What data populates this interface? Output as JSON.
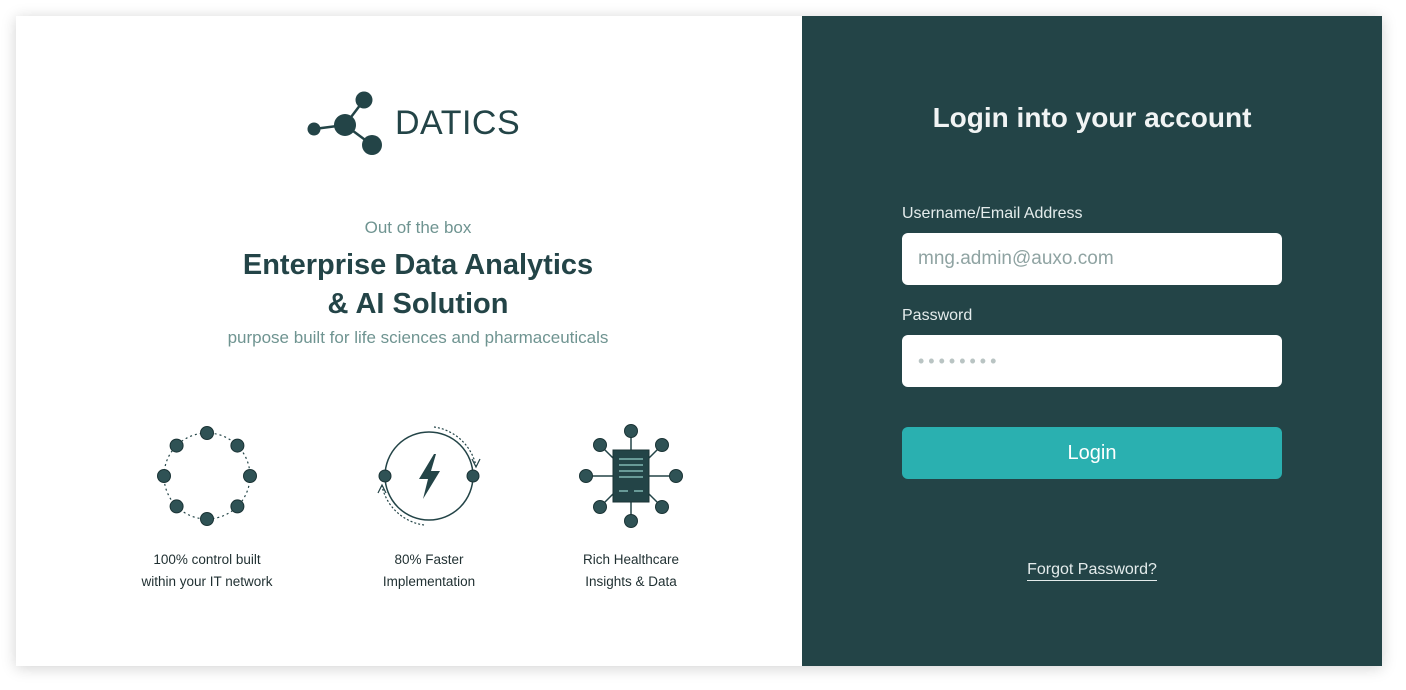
{
  "brand": {
    "name": "DATICS",
    "color": "#234447",
    "logo_icon": "molecule-network-icon"
  },
  "tagline": {
    "kicker": "Out of the box",
    "title_line1": "Enterprise Data Analytics",
    "title_line2": "& AI Solution",
    "subtitle": "purpose built for life sciences and pharmaceuticals"
  },
  "features": [
    {
      "icon": "ring-network-icon",
      "line1": "100% control built",
      "line2": "within your IT network"
    },
    {
      "icon": "lightning-cycle-icon",
      "line1": "80% Faster",
      "line2": "Implementation"
    },
    {
      "icon": "document-hub-icon",
      "line1": "Rich Healthcare",
      "line2": "Insights & Data"
    }
  ],
  "login": {
    "title": "Login into your account",
    "username_label": "Username/Email Address",
    "username_value": "mng.admin@auxo.com",
    "password_label": "Password",
    "password_value": "••••••••",
    "submit_label": "Login",
    "forgot_label": "Forgot Password?"
  },
  "colors": {
    "panel": "#234447",
    "accent": "#2ab0b0",
    "muted_text": "#6f9491"
  }
}
